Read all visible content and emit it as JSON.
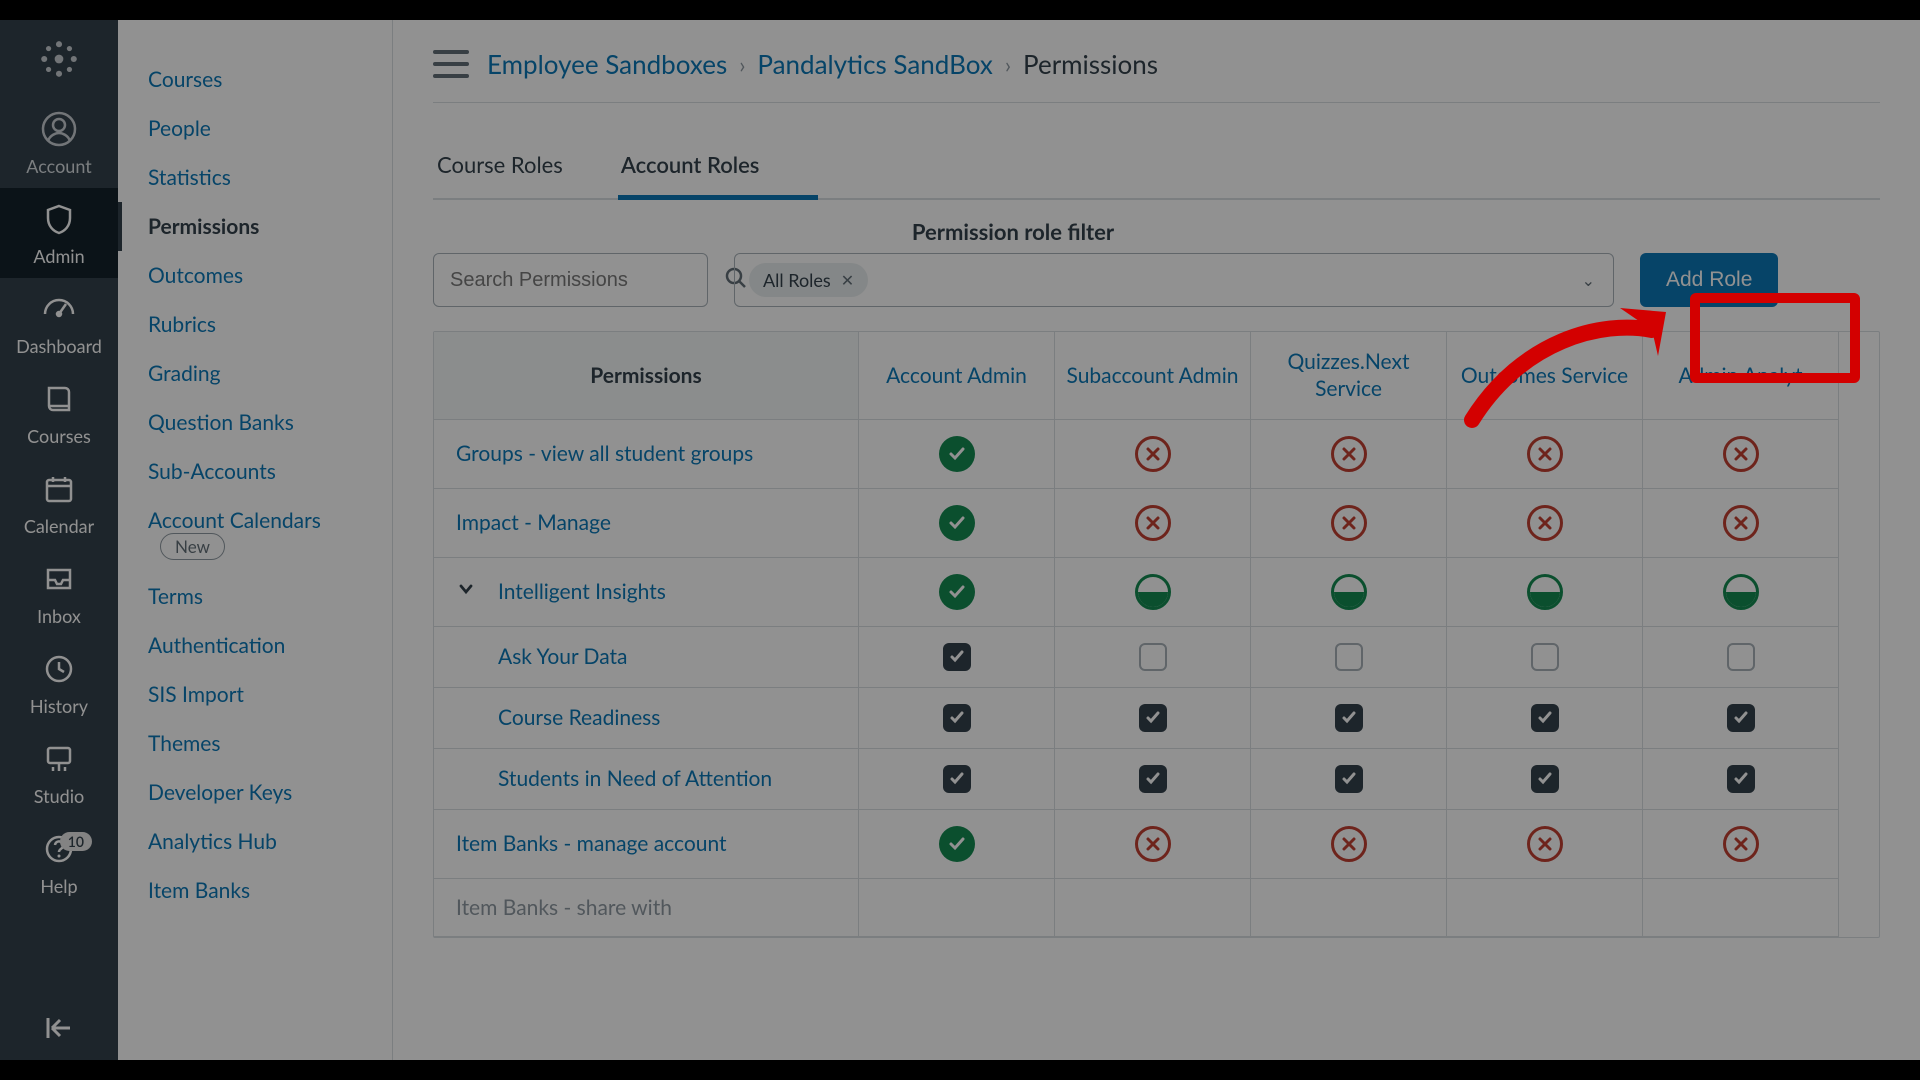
{
  "rail": {
    "items": [
      {
        "key": "logo",
        "label": ""
      },
      {
        "key": "account",
        "label": "Account"
      },
      {
        "key": "admin",
        "label": "Admin"
      },
      {
        "key": "dashboard",
        "label": "Dashboard"
      },
      {
        "key": "courses",
        "label": "Courses"
      },
      {
        "key": "calendar",
        "label": "Calendar"
      },
      {
        "key": "inbox",
        "label": "Inbox"
      },
      {
        "key": "history",
        "label": "History"
      },
      {
        "key": "studio",
        "label": "Studio"
      },
      {
        "key": "help",
        "label": "Help",
        "badge": "10"
      }
    ]
  },
  "breadcrumb": {
    "a": "Employee Sandboxes",
    "b": "Pandalytics SandBox",
    "c": "Permissions"
  },
  "subnav": {
    "items": [
      "Courses",
      "People",
      "Statistics",
      "Permissions",
      "Outcomes",
      "Rubrics",
      "Grading",
      "Question Banks",
      "Sub-Accounts",
      "Account Calendars",
      "Terms",
      "Authentication",
      "SIS Import",
      "Themes",
      "Developer Keys",
      "Analytics Hub",
      "Item Banks"
    ],
    "active": "Permissions",
    "new_item": "Account Calendars",
    "new_label": "New"
  },
  "tabs": {
    "course": "Course Roles",
    "account": "Account Roles"
  },
  "filter": {
    "title": "Permission role filter",
    "search_placeholder": "Search Permissions",
    "chip": "All Roles"
  },
  "add_role_label": "Add Role",
  "table": {
    "header_first": "Permissions",
    "roles": [
      "Account Admin",
      "Subaccount Admin",
      "Quizzes.Next Service",
      "Outcomes Service",
      "Admin Analyt"
    ],
    "rows": [
      {
        "name": "Groups - view all student groups",
        "indent": 0,
        "cells": [
          "on",
          "off",
          "off",
          "off",
          "off"
        ]
      },
      {
        "name": "Impact - Manage",
        "indent": 0,
        "cells": [
          "on",
          "off",
          "off",
          "off",
          "off"
        ]
      },
      {
        "name": "Intelligent Insights",
        "indent": 0,
        "expand": true,
        "cells": [
          "on",
          "partial",
          "partial",
          "partial",
          "partial"
        ]
      },
      {
        "name": "Ask Your Data",
        "indent": 1,
        "cells": [
          "chk_on",
          "chk_off",
          "chk_off",
          "chk_off",
          "chk_off"
        ]
      },
      {
        "name": "Course Readiness",
        "indent": 1,
        "cells": [
          "chk_on",
          "chk_on",
          "chk_on",
          "chk_on",
          "chk_on"
        ]
      },
      {
        "name": "Students in Need of Attention",
        "indent": 1,
        "cells": [
          "chk_on",
          "chk_on",
          "chk_on",
          "chk_on",
          "chk_on"
        ]
      },
      {
        "name": "Item Banks - manage account",
        "indent": 0,
        "cells": [
          "on",
          "off",
          "off",
          "off",
          "off"
        ]
      },
      {
        "name": "Item Banks - share with",
        "indent": 0,
        "faded": true,
        "cells": [
          "",
          "",
          "",
          "",
          ""
        ]
      }
    ]
  }
}
